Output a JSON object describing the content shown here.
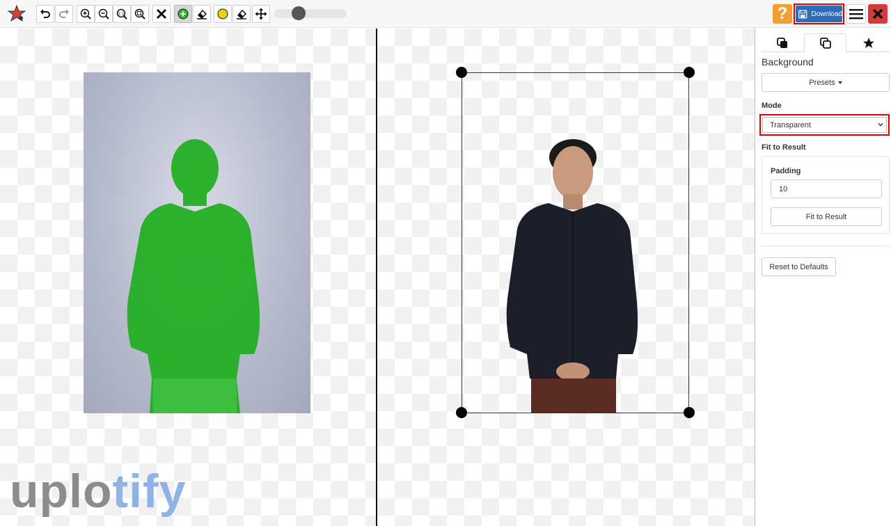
{
  "toolbar": {
    "app_logo": "star-logo-icon",
    "tools": [
      {
        "name": "undo-icon"
      },
      {
        "name": "redo-icon"
      },
      {
        "name": "zoom-in-icon"
      },
      {
        "name": "zoom-out-icon"
      },
      {
        "name": "zoom-actual-icon"
      },
      {
        "name": "zoom-fit-icon"
      },
      {
        "name": "clear-icon"
      },
      {
        "name": "keep-brush-icon"
      },
      {
        "name": "eraser-icon"
      },
      {
        "name": "remove-brush-icon"
      },
      {
        "name": "eraser-icon"
      },
      {
        "name": "move-icon"
      }
    ],
    "brush_size": 0.34,
    "help_label": "?",
    "download_label": "Download",
    "menu_icon": "hamburger-icon",
    "close_icon": "close-icon"
  },
  "colors": {
    "accent_blue": "#2d6db8",
    "highlight_red": "#e00000",
    "help_orange": "#f0a030",
    "close_red": "#d53a3a",
    "keep_green": "#2cbf2c",
    "remove_yellow": "#e9d215"
  },
  "panel": {
    "tabs": [
      {
        "icon": "layers-icon",
        "active": false
      },
      {
        "icon": "copy-icon",
        "active": true
      },
      {
        "icon": "star-icon",
        "active": false
      }
    ],
    "title": "Background",
    "presets_label": "Presets",
    "mode_label": "Mode",
    "mode_value": "Transparent",
    "fit_label": "Fit to Result",
    "padding_label": "Padding",
    "padding_value": "10",
    "fit_button": "Fit to Result",
    "reset_button": "Reset to Defaults"
  },
  "watermark": {
    "part1": "uplo",
    "part2": "tify"
  }
}
